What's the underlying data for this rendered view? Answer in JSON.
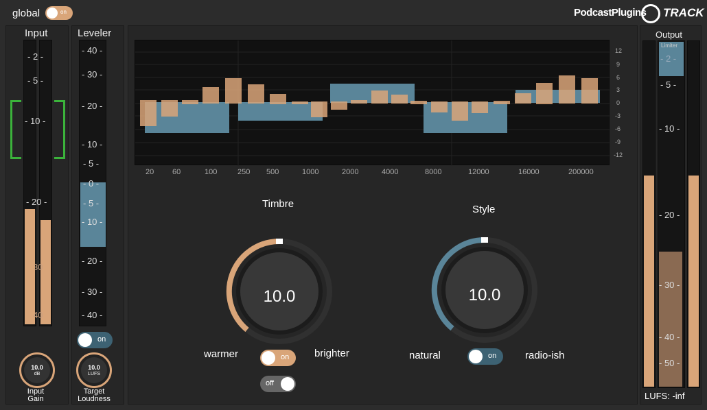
{
  "header": {
    "global_label": "global",
    "global_toggle": "on",
    "brand": "PodcastPlugins",
    "product": "TRACK"
  },
  "input": {
    "title": "Input",
    "scale": [
      "- 2 -",
      "- 5 -",
      "- 10 -",
      "- 20 -",
      "30",
      "40"
    ],
    "knob_value": "10.0",
    "knob_unit": "dB",
    "knob_label": "Input\nGain"
  },
  "leveler": {
    "title": "Leveler",
    "scale": [
      "- 40 -",
      "- 30 -",
      "- 20 -",
      "- 10 -",
      "- 5 -",
      "- 0 -",
      "- 5 -",
      "- 10 -",
      "- 20 -",
      "- 30 -",
      "- 40 -"
    ],
    "toggle": "on",
    "knob_value": "10.0",
    "knob_unit": "LUFS",
    "knob_label": "Target\nLoudness"
  },
  "eq": {
    "x_labels": [
      "20",
      "60",
      "100",
      "250",
      "500",
      "1000",
      "2000",
      "4000",
      "8000",
      "12000",
      "16000",
      "200000"
    ],
    "y_labels": [
      "12",
      "9",
      "6",
      "3",
      "0",
      "-3",
      "-6",
      "-9",
      "-12"
    ]
  },
  "timbre": {
    "title": "Timbre",
    "value": "10.0",
    "left": "warmer",
    "right": "brighter",
    "toggle1": "on",
    "toggle2": "off"
  },
  "style": {
    "title": "Style",
    "value": "10.0",
    "left": "natural",
    "right": "radio-ish",
    "toggle": "on"
  },
  "output": {
    "title": "Output",
    "limiter": "Limiter",
    "scale": [
      "- 2 -",
      "- 5 -",
      "- 10 -",
      "- 20 -",
      "- 30 -",
      "- 40 -",
      "- 50 -"
    ],
    "lufs": "LUFS: -inf"
  },
  "colors": {
    "accent_orange": "#d9a579",
    "accent_blue": "#5a8599",
    "green": "#3bb33b"
  }
}
